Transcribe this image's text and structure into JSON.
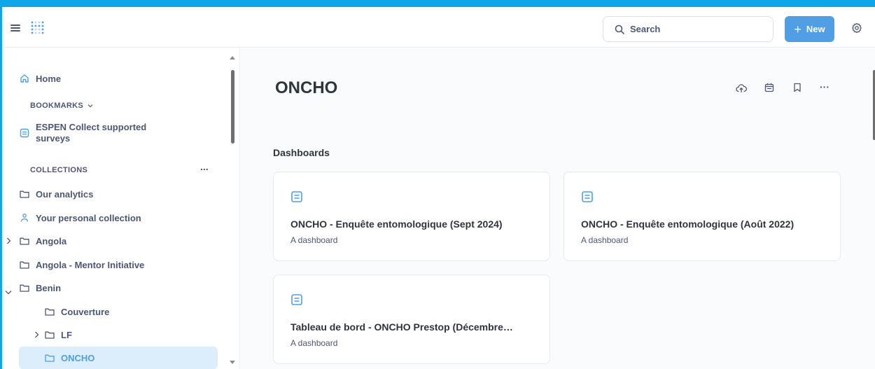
{
  "header": {
    "search_label": "Search",
    "new_label": "New"
  },
  "sidebar": {
    "home_label": "Home",
    "bookmarks_label": "BOOKMARKS",
    "bookmark_items": [
      {
        "label_line1": "ESPEN Collect supported",
        "label_line2": "surveys"
      }
    ],
    "collections_label": "COLLECTIONS",
    "collections": [
      {
        "label": "Our analytics"
      },
      {
        "label": "Your personal collection"
      },
      {
        "label": "Angola"
      },
      {
        "label": "Angola - Mentor Initiative"
      },
      {
        "label": "Benin"
      },
      {
        "label": "Couverture"
      },
      {
        "label": "LF"
      },
      {
        "label": "ONCHO"
      }
    ],
    "more_label": "..."
  },
  "main": {
    "title": "ONCHO",
    "more_label": "···",
    "section_heading": "Dashboards",
    "cards": [
      {
        "title": "ONCHO - Enquête entomologique (Sept 2024)",
        "subtitle": "A dashboard"
      },
      {
        "title": "ONCHO - Enquête entomologique (Août 2022)",
        "subtitle": "A dashboard"
      },
      {
        "title": "Tableau de bord - ONCHO Prestop (Décembre…",
        "subtitle": "A dashboard"
      }
    ]
  },
  "colors": {
    "accent": "#509ee3",
    "frame": "#0ea5e9",
    "active_bg": "#dceefb",
    "text": "#4c5773",
    "heading": "#2e353b"
  }
}
